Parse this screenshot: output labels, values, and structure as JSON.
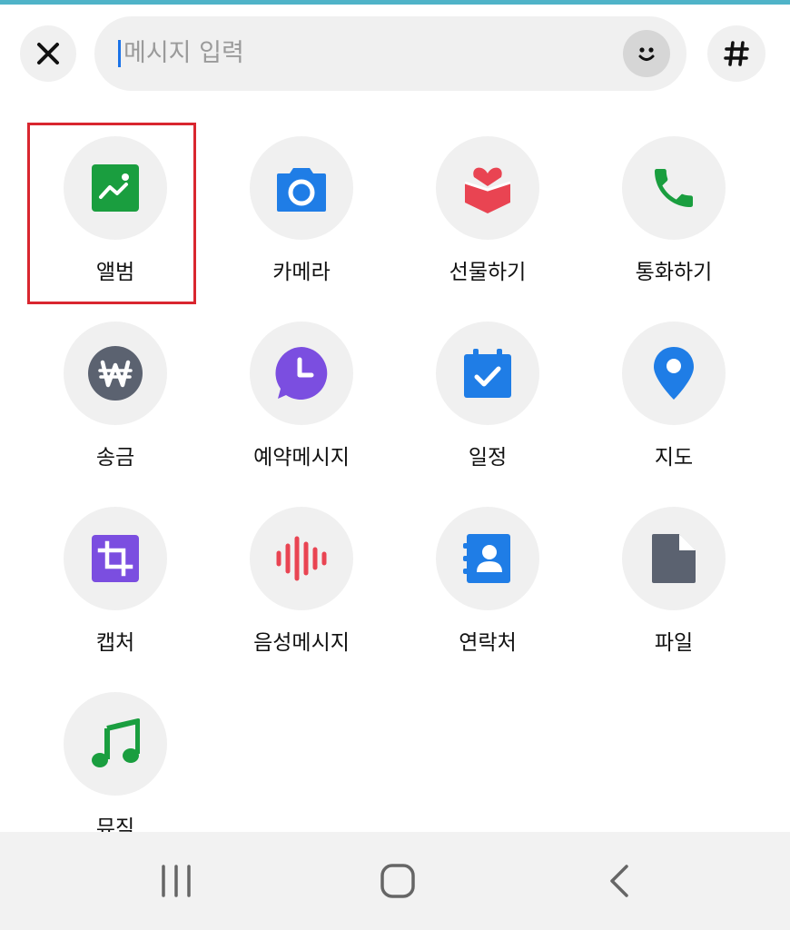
{
  "composer": {
    "close_icon": "close-icon",
    "placeholder": "메시지 입력",
    "emoji_icon": "smiley-icon",
    "hash_label": "#"
  },
  "grid": [
    {
      "label": "앨범",
      "icon": "album-icon",
      "color": "#1a9e3f",
      "highlighted": true
    },
    {
      "label": "카메라",
      "icon": "camera-icon",
      "color": "#1f7de6"
    },
    {
      "label": "선물하기",
      "icon": "gift-icon",
      "color": "#e94452"
    },
    {
      "label": "통화하기",
      "icon": "phone-icon",
      "color": "#1a9e3f"
    },
    {
      "label": "송금",
      "icon": "won-icon",
      "color": "#5b6270"
    },
    {
      "label": "예약메시지",
      "icon": "scheduled-message-icon",
      "color": "#7b4ee0"
    },
    {
      "label": "일정",
      "icon": "calendar-icon",
      "color": "#1f7de6"
    },
    {
      "label": "지도",
      "icon": "map-pin-icon",
      "color": "#1f7de6"
    },
    {
      "label": "캡처",
      "icon": "crop-icon",
      "color": "#7b4ee0"
    },
    {
      "label": "음성메시지",
      "icon": "voice-wave-icon",
      "color": "#e94452"
    },
    {
      "label": "연락처",
      "icon": "contact-icon",
      "color": "#1f7de6"
    },
    {
      "label": "파일",
      "icon": "file-icon",
      "color": "#5b6270"
    },
    {
      "label": "뮤직",
      "icon": "music-icon",
      "color": "#1a9e3f"
    }
  ],
  "nav": {
    "recent": "recent-apps-icon",
    "home": "home-icon",
    "back": "back-icon"
  }
}
